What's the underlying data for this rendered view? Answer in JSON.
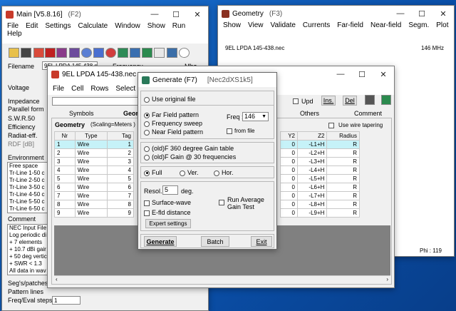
{
  "main": {
    "title": "Main [V5.8.16]",
    "hotkey": "(F2)",
    "menu": [
      "File",
      "Edit",
      "Settings",
      "Calculate",
      "Window",
      "Show",
      "Run",
      "Help"
    ],
    "filename_label": "Filename",
    "filename_value": "9EL LPDA 145-438.nec",
    "frequency_label": "Frequency",
    "frequency_unit": "Mhz",
    "labels": [
      "Voltage",
      "Impedance",
      "Parallel form",
      "S.W.R.50",
      "Efficiency",
      "Radiat-eff.",
      "RDF [dB]",
      "Environment"
    ],
    "environment_items": [
      "Free space",
      "Tr-Line  1-50 c",
      "Tr-Line  2-50 c",
      "Tr-Line  3-50 c",
      "Tr-Line  4-50 c",
      "Tr-Line  5-50 c",
      "Tr-Line  6-50 c"
    ],
    "comment_label": "Comment",
    "comment_lines": [
      "NEC Input File",
      "Log periodic di",
      "+ 7 elements",
      "+ 10.7 dBi gair",
      "+ 50 deg vertic",
      "+ SWR < 1.3",
      "All data in wav"
    ],
    "segs_label": "Seg's/patches",
    "pattern_label": "Pattern lines",
    "freq_eval_label": "Freq/Eval steps",
    "freq_eval_value": "1"
  },
  "geometry": {
    "title": "Geometry",
    "hotkey": "(F3)",
    "menu": [
      "Show",
      "View",
      "Validate",
      "Currents",
      "Far-field",
      "Near-field",
      "Segm.",
      "Plot"
    ],
    "file_label": "9EL LPDA 145-438.nec",
    "freq_label": "146 MHz",
    "phi_label": "Phi : 119"
  },
  "editor": {
    "title": "9EL LPDA 145-438.nec",
    "menu": [
      "File",
      "Cell",
      "Rows",
      "Select"
    ],
    "tabs": [
      "Symbols",
      "Geometry",
      "Others",
      "Comment"
    ],
    "geometry_header": "Geometry",
    "scaling": "(Scaling=Meters )",
    "upd_label": "Upd",
    "ins_label": "Ins.",
    "del_label": "Del",
    "wire_taper_label": "Use wire tapering",
    "columns_left": [
      "Nr",
      "Type",
      "Tag"
    ],
    "columns_right": [
      "Y2",
      "Z2",
      "Radius"
    ],
    "rows": [
      {
        "nr": "1",
        "type": "Wire",
        "tag": "1",
        "y2": "0",
        "z2": "-L1+H",
        "r": "R"
      },
      {
        "nr": "2",
        "type": "Wire",
        "tag": "2",
        "y2": "0",
        "z2": "-L2+H",
        "r": "R"
      },
      {
        "nr": "3",
        "type": "Wire",
        "tag": "3",
        "y2": "0",
        "z2": "-L3+H",
        "r": "R"
      },
      {
        "nr": "4",
        "type": "Wire",
        "tag": "4",
        "y2": "0",
        "z2": "-L4+H",
        "r": "R"
      },
      {
        "nr": "5",
        "type": "Wire",
        "tag": "5",
        "y2": "0",
        "z2": "-L5+H",
        "r": "R"
      },
      {
        "nr": "6",
        "type": "Wire",
        "tag": "6",
        "y2": "0",
        "z2": "-L6+H",
        "r": "R"
      },
      {
        "nr": "7",
        "type": "Wire",
        "tag": "7",
        "y2": "0",
        "z2": "-L7+H",
        "r": "R"
      },
      {
        "nr": "8",
        "type": "Wire",
        "tag": "8",
        "y2": "0",
        "z2": "-L8+H",
        "r": "R"
      },
      {
        "nr": "9",
        "type": "Wire",
        "tag": "9",
        "y2": "0",
        "z2": "-L9+H",
        "r": "R"
      }
    ]
  },
  "generate": {
    "title": "Generate (F7)",
    "subtitle": "[Nec2dXS1k5]",
    "use_original": "Use original file",
    "far_field": "Far Field pattern",
    "freq_sweep": "Frequency sweep",
    "near_field": "Near Field pattern",
    "freq_label": "Freq :",
    "freq_value": "146",
    "from_file": "from file",
    "gain_360": "(old)F 360 degree Gain table",
    "gain_30": "(old)F Gain @ 30 frequencies",
    "full": "Full",
    "ver": "Ver.",
    "hor": "Hor.",
    "resol_label": "Resol.",
    "resol_value": "5",
    "deg": "deg.",
    "surface_wave": "Surface-wave",
    "e_fld": "E-fld distance",
    "run_avg": "Run Average Gain Test",
    "expert": "Expert settings",
    "generate_btn": "Generate",
    "batch_btn": "Batch",
    "exit_btn": "Exit"
  },
  "colors": {
    "selected_row": "#c6f2f8",
    "dialog_accent": "#2a7a5a",
    "desk": "#0a5bb5"
  }
}
